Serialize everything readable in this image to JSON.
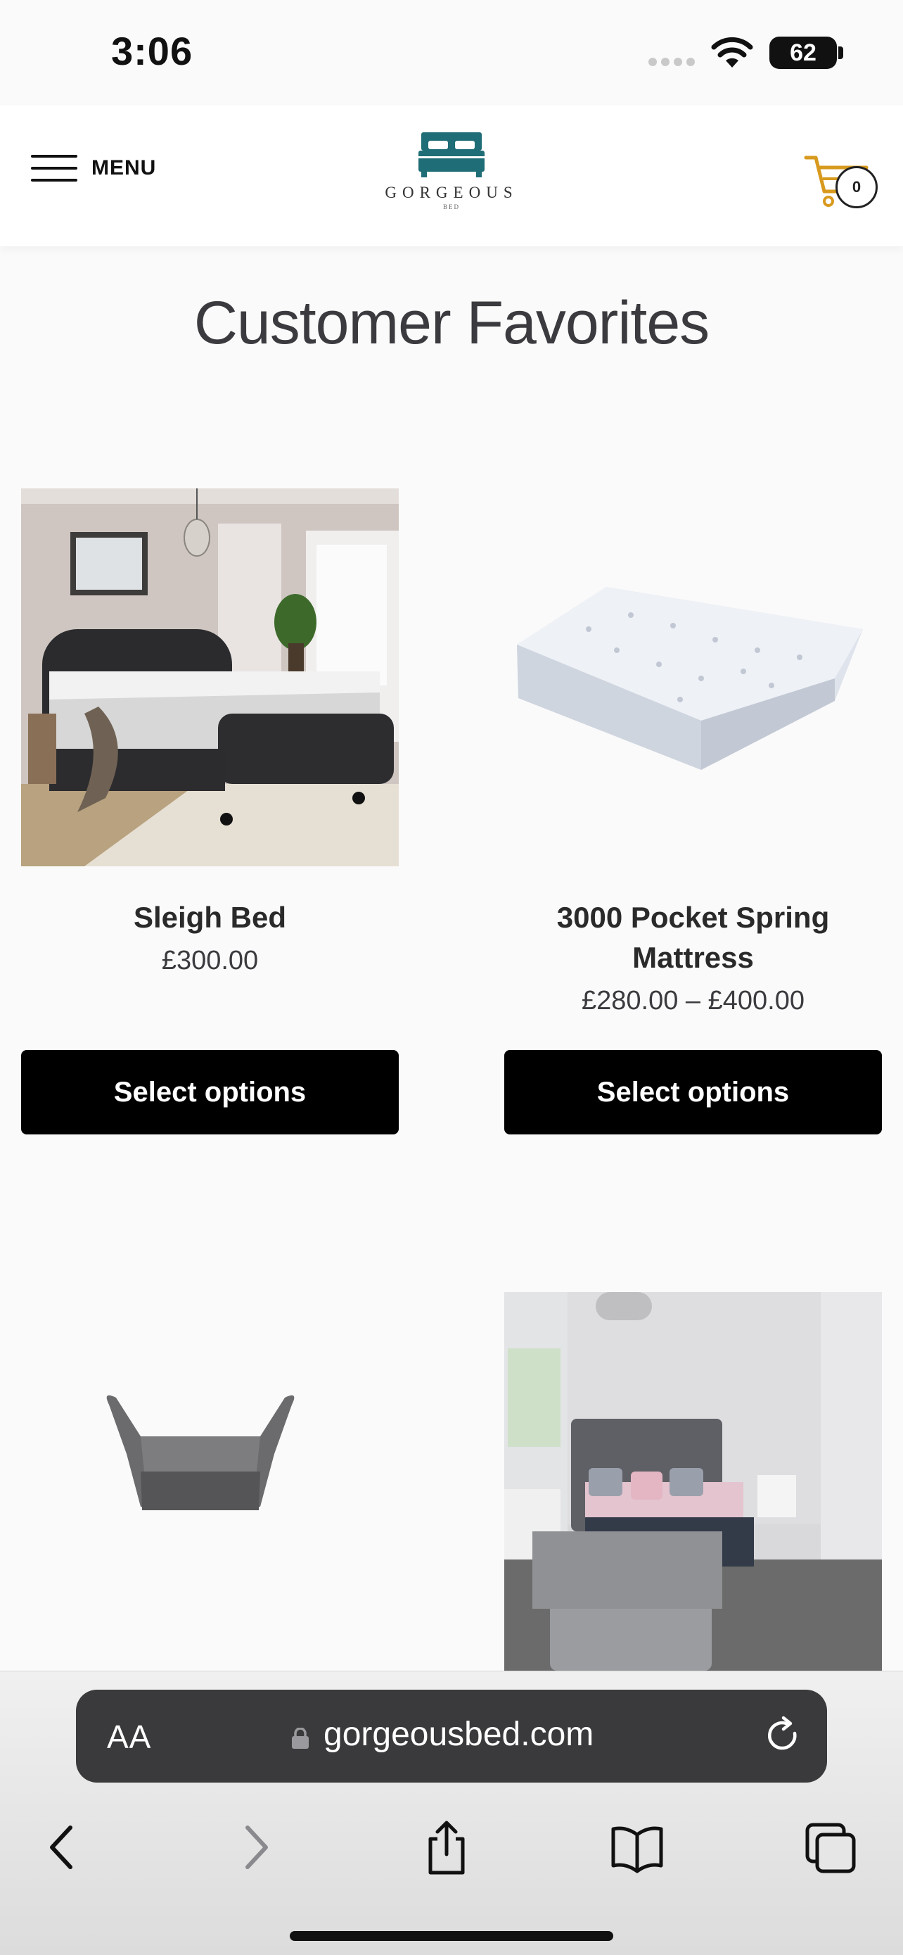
{
  "status_bar": {
    "time": "3:06",
    "battery": "62"
  },
  "header": {
    "menu_label": "MENU",
    "logo_text": "GORGEOUS",
    "logo_sub": "BED",
    "cart_count": "0"
  },
  "main": {
    "title": "Customer Favorites",
    "products": [
      {
        "name": "Sleigh Bed",
        "price": "£300.00",
        "button": "Select options"
      },
      {
        "name": "3000 Pocket Spring Mattress",
        "price": "£280.00 – £400.00",
        "button": "Select options"
      }
    ]
  },
  "browser": {
    "text_size_label": "AA",
    "url": "gorgeousbed.com"
  },
  "colors": {
    "brand_teal": "#1f6d76",
    "cart_orange": "#d89a1e",
    "button_black": "#000000"
  }
}
